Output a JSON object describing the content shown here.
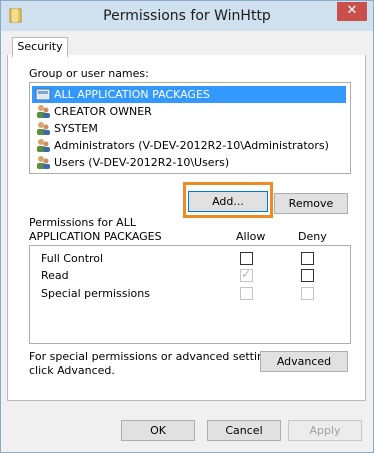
{
  "window": {
    "title": "Permissions for WinHttp"
  },
  "tabs": [
    {
      "label": "Security"
    }
  ],
  "group_label": "Group or user names:",
  "users": [
    {
      "name": "ALL APPLICATION PACKAGES",
      "selected": true
    },
    {
      "name": "CREATOR OWNER"
    },
    {
      "name": "SYSTEM"
    },
    {
      "name": "Administrators (V-DEV-2012R2-10\\Administrators)"
    },
    {
      "name": "Users (V-DEV-2012R2-10\\Users)"
    }
  ],
  "buttons": {
    "add": "Add...",
    "remove": "Remove",
    "advanced": "Advanced",
    "ok": "OK",
    "cancel": "Cancel",
    "apply": "Apply"
  },
  "permissions_header": {
    "line1": "Permissions for ALL",
    "line2": "APPLICATION PACKAGES",
    "allow": "Allow",
    "deny": "Deny"
  },
  "permissions": [
    {
      "name": "Full Control",
      "allow": false,
      "deny": false,
      "allow_disabled": false,
      "deny_disabled": false
    },
    {
      "name": "Read",
      "allow": true,
      "deny": false,
      "allow_disabled": true,
      "deny_disabled": false
    },
    {
      "name": "Special permissions",
      "allow": false,
      "deny": false,
      "allow_disabled": true,
      "deny_disabled": true
    }
  ],
  "advanced_text": {
    "line1": "For special permissions or advanced settings,",
    "line2": "click Advanced."
  },
  "colors": {
    "selection": "#3399ff",
    "highlight_box": "#f08a24",
    "close": "#c7504a"
  },
  "icons": {
    "title": "folder-icon",
    "close": "close-icon",
    "user": "user-group-icon",
    "package": "package-icon"
  }
}
